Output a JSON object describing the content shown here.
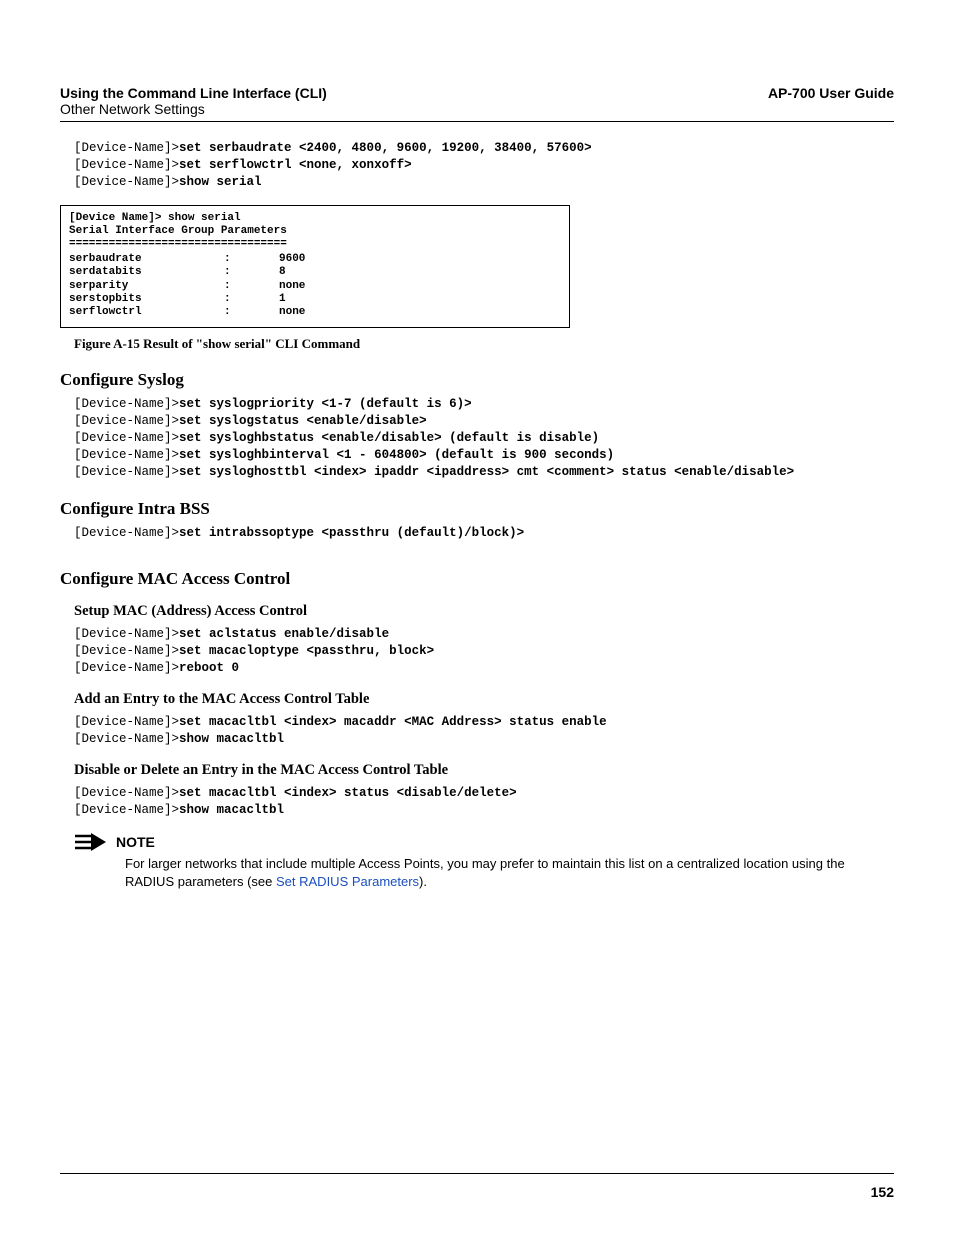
{
  "header": {
    "title": "Using the Command Line Interface (CLI)",
    "subtitle": "Other Network Settings",
    "guide": "AP-700 User Guide"
  },
  "cli_top": {
    "p1": "[Device-Name]>",
    "c1": "set serbaudrate <2400, 4800, 9600, 19200, 38400, 57600>",
    "p2": "[Device-Name]>",
    "c2": "set serflowctrl <none, xonxoff>",
    "p3": "[Device-Name]>",
    "c3": "show serial"
  },
  "figure": {
    "hdr1": "[Device Name]> show serial",
    "hdr2": "Serial Interface Group Parameters",
    "rule": "=================================",
    "rows": [
      {
        "k": "serbaudrate",
        "v": "9600"
      },
      {
        "k": "serdatabits",
        "v": "8"
      },
      {
        "k": "serparity",
        "v": "none"
      },
      {
        "k": "serstopbits",
        "v": "1"
      },
      {
        "k": "serflowctrl",
        "v": "none"
      }
    ],
    "caption": "Figure A-15   Result of \"show serial\" CLI Command"
  },
  "syslog": {
    "title": "Configure Syslog",
    "p": "[Device-Name]>",
    "c1": "set syslogpriority <1-7 (default is 6)>",
    "c2": "set syslogstatus <enable/disable>",
    "c3": "set sysloghbstatus <enable/disable> (default is disable)",
    "c4": "set sysloghbinterval <1 - 604800> (default is 900 seconds)",
    "c5": "set sysloghosttbl <index> ipaddr <ipaddress> cmt <comment> status <enable/disable>"
  },
  "intrabss": {
    "title": "Configure Intra BSS",
    "p": "[Device-Name]>",
    "c1": "set intrabssoptype <passthru (default)/block)>"
  },
  "mac": {
    "title": "Configure MAC Access Control",
    "setup": {
      "title": "Setup MAC (Address) Access Control",
      "p": "[Device-Name]>",
      "c1": "set aclstatus enable/disable",
      "c2": "set macacloptype <passthru, block>",
      "c3": "reboot 0"
    },
    "add": {
      "title": "Add an Entry to the MAC Access Control Table",
      "p": "[Device-Name]>",
      "c1": "set macacltbl <index> macaddr <MAC Address> status enable",
      "c2": "show macacltbl"
    },
    "del": {
      "title": "Disable or Delete an Entry in the MAC Access Control Table",
      "p": "[Device-Name]>",
      "c1": "set macacltbl <index> status <disable/delete>",
      "c2": "show macacltbl"
    }
  },
  "note": {
    "label": "NOTE",
    "body_pre": "For larger networks that include multiple Access Points, you may prefer to maintain this list on a centralized location using the RADIUS parameters (see ",
    "link": "Set RADIUS Parameters",
    "body_post": ")."
  },
  "page_number": "152"
}
